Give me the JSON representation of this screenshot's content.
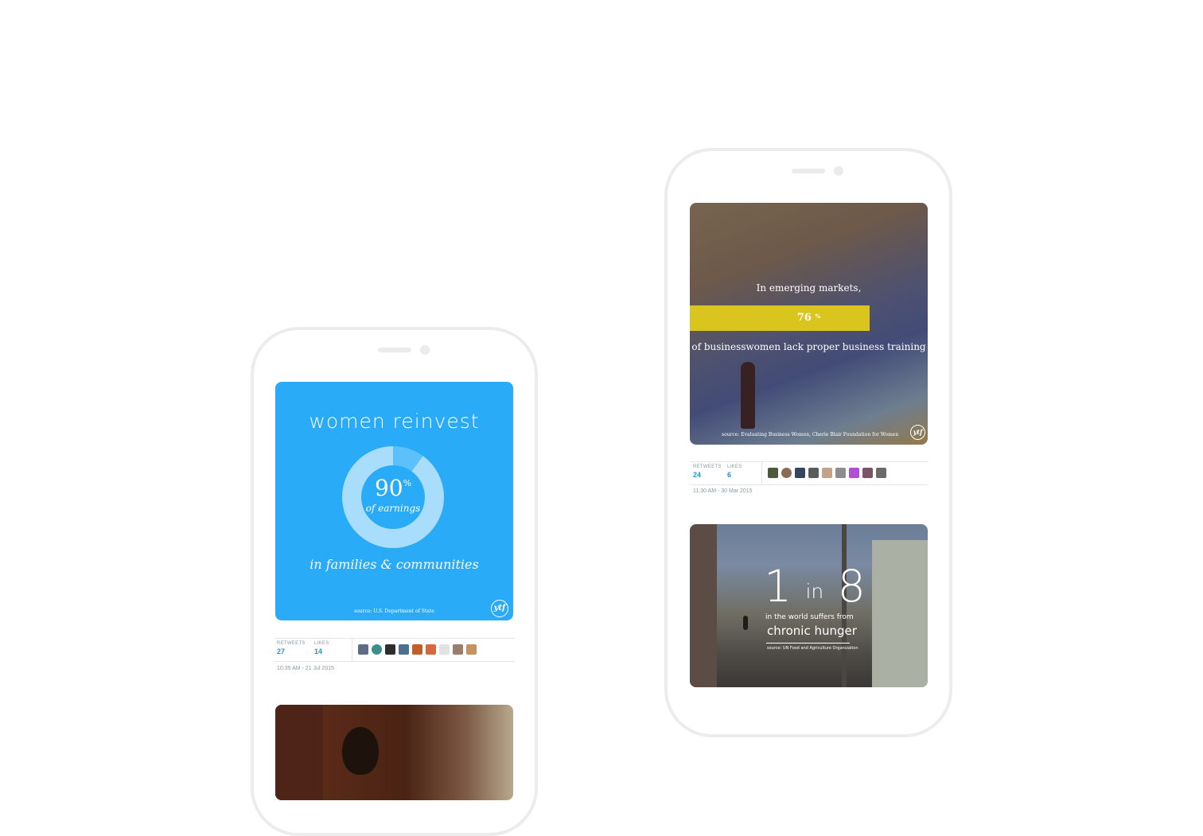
{
  "cards": {
    "women_reinvest": {
      "title": "women reinvest",
      "percent": "90",
      "percent_sign": "%",
      "percent_value": 0.9,
      "percent_caption": "of earnings",
      "subtitle": "in families & communities",
      "source": "source: U.S. Department of State",
      "logo": "ytf",
      "colors": {
        "background": "#29abf7",
        "ring": "#a8ddfb",
        "ring_gap": "#5cc1fa"
      }
    },
    "emerging_markets": {
      "line1": "In emerging markets,",
      "percent": "76",
      "percent_sign": "%",
      "line2": "of businesswomen lack proper business training",
      "source": "source: Evaluating Business Women, Cherie Blair Foundation for Women",
      "logo": "ytf",
      "band_color": "#d9c51e"
    },
    "hunger": {
      "num1": "1",
      "in": "in",
      "num2": "8",
      "line1": "in the world suffers from",
      "line2": "chronic hunger",
      "source": "source: UN Food and Agriculture Organization"
    }
  },
  "tweet_left": {
    "retweets_label": "RETWEETS",
    "retweets": "27",
    "likes_label": "LIKES",
    "likes": "14",
    "timestamp": "10:35 AM - 21 Jul 2015",
    "avatar_colors": [
      "#5b6e86",
      "#3a8f8c",
      "#2d2d2d",
      "#4f6f8f",
      "#c45d2a",
      "#d9673c",
      "#e2e2e2",
      "#9c7c6c",
      "#c7925f"
    ]
  },
  "tweet_right": {
    "retweets_label": "RETWEETS",
    "retweets": "24",
    "likes_label": "LIKES",
    "likes": "6",
    "timestamp": "11:30 AM - 30 Mar 2015",
    "avatar_colors": [
      "#4d5a3a",
      "#8a6b55",
      "#34465f",
      "#5b5b5b",
      "#c4a287",
      "#8d8d8d",
      "#b04fd3",
      "#7a5366",
      "#6a6a6a"
    ]
  }
}
